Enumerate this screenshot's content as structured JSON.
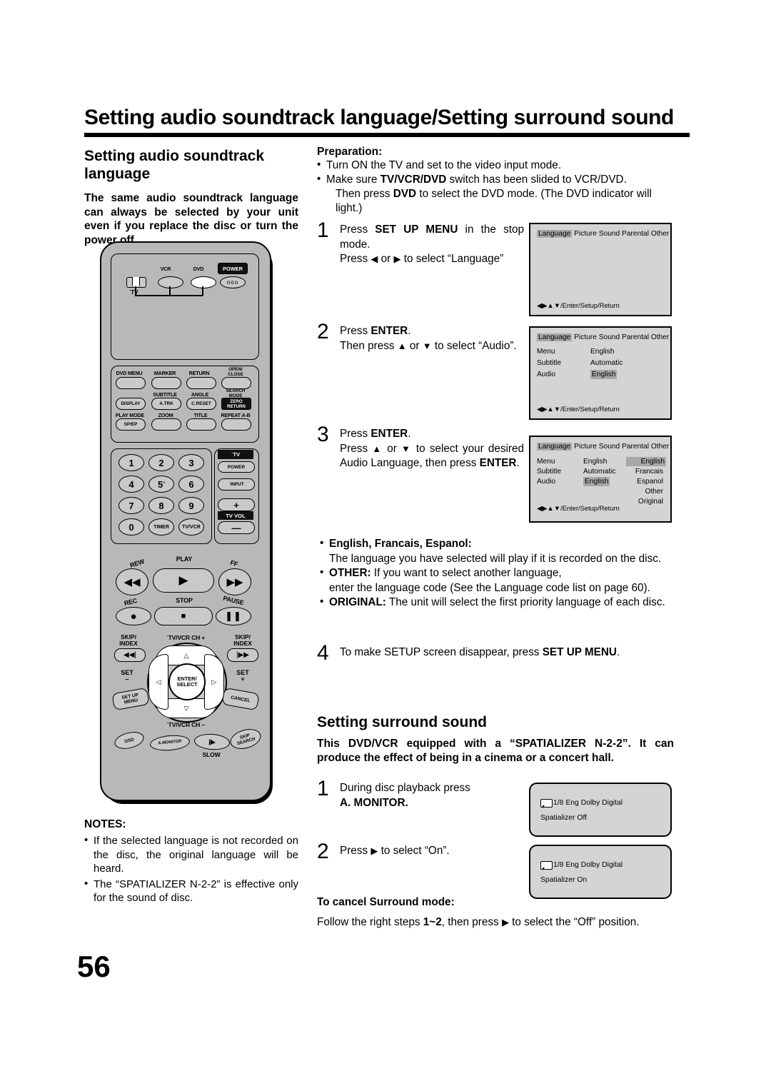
{
  "header": {
    "title": "Setting audio soundtrack language/Setting surround sound"
  },
  "left_column": {
    "section_heading": "Setting audio soundtrack language",
    "lead_paragraph": "The same audio soundtrack language can always be selected by your unit even if you replace the disc or turn the power off.",
    "notes_heading": "NOTES:",
    "notes": [
      "If the selected language is not recorded on the disc, the original language will be heard.",
      "The “SPATIALIZER N-2-2” is effective only for the sound of disc."
    ]
  },
  "page_number": "56",
  "remote": {
    "mode_labels": {
      "vcr": "VCR",
      "dvd": "DVD",
      "tv": "TV",
      "power": "POWER"
    },
    "row1": [
      "DVD MENU",
      "MARKER",
      "RETURN",
      "OPEN/ CLOSE"
    ],
    "row2_top": [
      "",
      "SUBTITLE",
      "ANGLE",
      "SEARCH MODE"
    ],
    "row2_btn": [
      "DISPLAY",
      "A.TRK",
      "C.RESET",
      "ZERO RETURN"
    ],
    "row3_top": [
      "PLAY MODE",
      "ZOOM",
      "TITLE",
      "REPEAT A-B"
    ],
    "row3_btn": [
      "SP/EP",
      "",
      "",
      ""
    ],
    "numbers": [
      "1",
      "2",
      "3",
      "4",
      "5",
      "6",
      "7",
      "8",
      "9",
      "0",
      "TIMER",
      "TV/VCR"
    ],
    "tv_side": [
      "TV",
      "POWER",
      "INPUT",
      "+",
      "TV VOL",
      "—"
    ],
    "transport": {
      "rew": "REW",
      "play": "PLAY",
      "ff": "FF",
      "rec": "REC",
      "stop": "STOP",
      "pause": "PAUSE"
    },
    "dpad": {
      "up_label": "TV/VCR CH +",
      "down_label": "TV/VCR CH –",
      "center": "ENTER/ SELECT",
      "left_skip": "SKIP/ INDEX",
      "right_skip": "SKIP/ INDEX",
      "set_minus": "SET –",
      "set_plus": "SET +",
      "setup_menu": "SET UP MENU",
      "cancel": "CANCEL"
    },
    "bottom_row": [
      "OSD",
      "A.MONITOR",
      "SLOW",
      "SKIP SEARCH"
    ]
  },
  "right_column": {
    "preparation_heading": "Preparation:",
    "preparation_items": [
      {
        "text": "Turn ON the TV and set to the video input mode."
      },
      {
        "text": "Make sure TV/VCR/DVD switch has been slided to VCR/DVD.",
        "cont": "Then press DVD to select the DVD mode. (The DVD indicator will light.)"
      }
    ],
    "steps": [
      {
        "num": "1",
        "lines": [
          "Press SET UP MENU in the stop mode.",
          "Press ◀ or ▶ to select “Language”"
        ]
      },
      {
        "num": "2",
        "lines": [
          "Press ENTER.",
          "Then press ▲ or ▼ to select “Audio”."
        ]
      },
      {
        "num": "3",
        "lines": [
          "Press ENTER.",
          "Press ▲ or ▼ to select your desired Audio Language, then press ENTER."
        ]
      },
      {
        "num": "4",
        "lines": [
          "To make SETUP screen disappear, press SET UP MENU."
        ]
      }
    ],
    "language_bullets": [
      {
        "title": "English, Francais, Espanol:",
        "body": "The language you have selected will play if it is recorded on the disc."
      },
      {
        "title": "OTHER:",
        "body": "If you want to select another language, enter the language code (See the Language code list on page 60)."
      },
      {
        "title": "ORIGINAL:",
        "body": "The unit will select the first priority language of each disc."
      }
    ],
    "surround": {
      "heading": "Setting surround sound",
      "lead": "This DVD/VCR equipped with a “SPATIALIZER N-2-2”. It can produce the effect of being in a cinema or a concert hall.",
      "steps": [
        {
          "num": "1",
          "lines": [
            "During disc playback press",
            "A. MONITOR."
          ]
        },
        {
          "num": "2",
          "lines": [
            "Press ▶ to select “On”."
          ]
        }
      ],
      "cancel_heading": "To cancel Surround mode",
      "cancel_text": "Follow the right steps 1~2, then press ▶ to select the “Off” position."
    }
  },
  "osd_screens": {
    "screen1": {
      "tabs": [
        "Language",
        "Picture",
        "Sound",
        "Parental",
        "Other"
      ],
      "selected_tab": "Language",
      "footer": "◀▶▲▼/Enter/Setup/Return"
    },
    "screen2": {
      "tabs": [
        "Language",
        "Picture",
        "Sound",
        "Parental",
        "Other"
      ],
      "selected_tab": "Language",
      "rows": [
        {
          "label": "Menu",
          "value": "English",
          "highlighted": false
        },
        {
          "label": "Subtitle",
          "value": "Automatic",
          "highlighted": false
        },
        {
          "label": "Audio",
          "value": "English",
          "highlighted": true
        }
      ],
      "footer": "◀▶▲▼/Enter/Setup/Return"
    },
    "screen3": {
      "tabs": [
        "Language",
        "Picture",
        "Sound",
        "Parental",
        "Other"
      ],
      "selected_tab": "Language",
      "rows": [
        {
          "label": "Menu",
          "value": "English"
        },
        {
          "label": "Subtitle",
          "value": "Automatic"
        },
        {
          "label": "Audio",
          "value": "English"
        }
      ],
      "options": [
        "English",
        "Francais",
        "Espanol",
        "Other",
        "Original"
      ],
      "selected_option": "English",
      "footer": "◀▶▲▼/Enter/Setup/Return"
    },
    "osd_off": {
      "line1": "1/8 Eng Dolby Digital",
      "line2": "Spatializer Off"
    },
    "osd_on": {
      "line1": "1/8 Eng Dolby Digital",
      "line2": "Spatializer On"
    }
  }
}
